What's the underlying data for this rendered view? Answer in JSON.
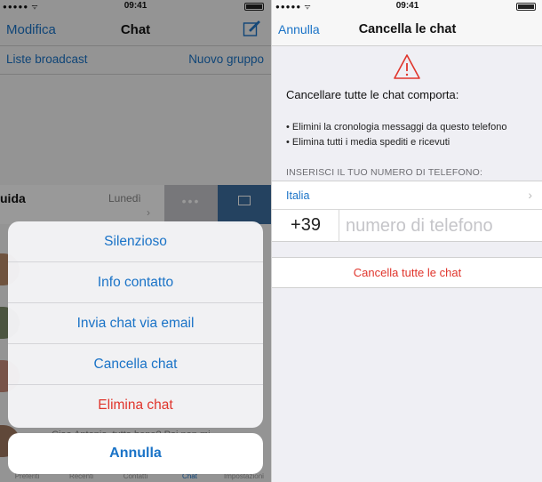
{
  "left": {
    "status": {
      "time": "09:41"
    },
    "nav": {
      "edit_label": "Modifica",
      "title": "Chat",
      "compose_icon": "compose-icon"
    },
    "links": {
      "broadcast": "Liste broadcast",
      "new_group": "Nuovo gruppo"
    },
    "chat_row": {
      "name": "uida",
      "date": "Lunedì"
    },
    "preview_text": "Ciao Antonio, tutto bene? Poi non mi",
    "tabs": [
      {
        "label": "Preferiti",
        "active": false
      },
      {
        "label": "Recenti",
        "active": false
      },
      {
        "label": "Contatti",
        "active": false
      },
      {
        "label": "Chat",
        "active": true
      },
      {
        "label": "Impostazioni",
        "active": false
      }
    ],
    "action_sheet": {
      "options": [
        {
          "label": "Silenzioso",
          "destructive": false
        },
        {
          "label": "Info contatto",
          "destructive": false
        },
        {
          "label": "Invia chat via email",
          "destructive": false
        },
        {
          "label": "Cancella chat",
          "destructive": false
        },
        {
          "label": "Elimina chat",
          "destructive": true
        }
      ],
      "cancel_label": "Annulla"
    }
  },
  "right": {
    "status": {
      "time": "09:41"
    },
    "nav": {
      "cancel_label": "Annulla",
      "title": "Cancella le chat"
    },
    "warning_icon": "warning-triangle-icon",
    "warning_heading": "Cancellare tutte le chat comporta:",
    "bullets": [
      "• Elimini la cronologia messaggi da questo telefono",
      "• Elimina tutti i media spediti e ricevuti"
    ],
    "section_header": "INSERISCI IL TUO NUMERO DI TELEFONO:",
    "country": "Italia",
    "country_code": "+39",
    "phone_placeholder": "numero di telefono",
    "delete_all_label": "Cancella tutte le chat"
  },
  "colors": {
    "accent": "#1a73c7",
    "destructive": "#e0352c",
    "archive": "#3d6fa0"
  }
}
